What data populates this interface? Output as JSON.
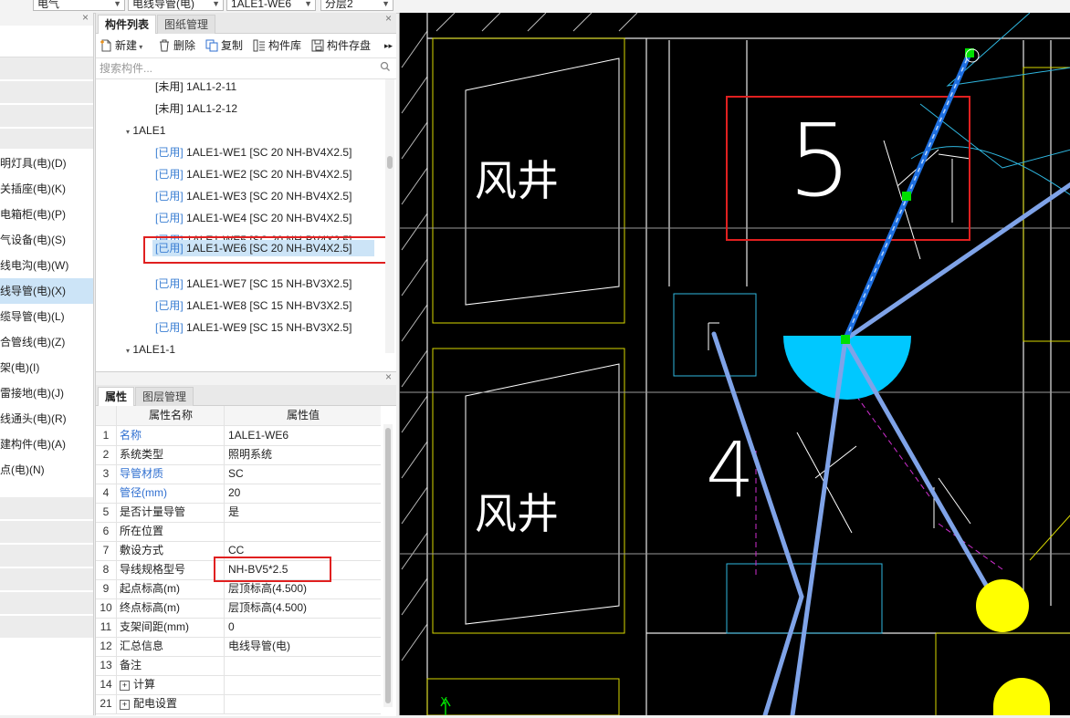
{
  "topbar": {
    "combos": [
      "电气",
      "电线导管(电)",
      "1ALE1-WE6",
      "分层2"
    ]
  },
  "leftnav": {
    "items": [
      {
        "label": "明灯具(电)(D)"
      },
      {
        "label": "关插座(电)(K)"
      },
      {
        "label": "电箱柜(电)(P)"
      },
      {
        "label": "气设备(电)(S)"
      },
      {
        "label": "线电沟(电)(W)"
      },
      {
        "label": "线导管(电)(X)"
      },
      {
        "label": "缆导管(电)(L)"
      },
      {
        "label": "合管线(电)(Z)"
      },
      {
        "label": "架(电)(I)"
      },
      {
        "label": "雷接地(电)(J)"
      },
      {
        "label": "线通头(电)(R)"
      },
      {
        "label": "建构件(电)(A)"
      },
      {
        "label": "点(电)(N)"
      }
    ]
  },
  "complist": {
    "tabs": [
      "构件列表",
      "图纸管理"
    ],
    "toolbar": {
      "new": "新建",
      "delete": "删除",
      "copy": "复制",
      "library": "构件库",
      "save": "构件存盘"
    },
    "search_placeholder": "搜索构件...",
    "tree": [
      {
        "tag": "[未用]",
        "name": "1AL1-2-11",
        "used": false,
        "level": 2
      },
      {
        "tag": "[未用]",
        "name": "1AL1-2-12",
        "used": false,
        "level": 2
      },
      {
        "tag": "",
        "name": "1ALE1",
        "used": false,
        "level": 1
      },
      {
        "tag": "[已用]",
        "name": "1ALE1-WE1 [SC 20 NH-BV4X2.5]",
        "used": true,
        "level": 2
      },
      {
        "tag": "[已用]",
        "name": "1ALE1-WE2 [SC 20 NH-BV4X2.5]",
        "used": true,
        "level": 2
      },
      {
        "tag": "[已用]",
        "name": "1ALE1-WE3 [SC 20 NH-BV4X2.5]",
        "used": true,
        "level": 2
      },
      {
        "tag": "[已用]",
        "name": "1ALE1-WE4 [SC 20 NH-BV4X2.5]",
        "used": true,
        "level": 2
      },
      {
        "tag": "[已用]",
        "name": "1ALE1-WE5 [SC 20 NH-BV4X2.5]",
        "used": true,
        "level": 2
      },
      {
        "tag": "[已用]",
        "name": "1ALE1-WE6 [SC 20 NH-BV4X2.5]",
        "used": true,
        "level": 2
      },
      {
        "tag": "[已用]",
        "name": "1ALE1-WE7 [SC 15 NH-BV3X2.5]",
        "used": true,
        "level": 2
      },
      {
        "tag": "[已用]",
        "name": "1ALE1-WE8 [SC 15 NH-BV3X2.5]",
        "used": true,
        "level": 2
      },
      {
        "tag": "[已用]",
        "name": "1ALE1-WE9 [SC 15 NH-BV3X2.5]",
        "used": true,
        "level": 2
      },
      {
        "tag": "",
        "name": "1ALE1-1",
        "used": false,
        "level": 1
      }
    ]
  },
  "props": {
    "tabs": [
      "属性",
      "图层管理"
    ],
    "col_name": "属性名称",
    "col_value": "属性值",
    "rows": [
      {
        "n": "1",
        "k": "名称",
        "v": "1ALE1-WE6",
        "blue": true
      },
      {
        "n": "2",
        "k": "系统类型",
        "v": "照明系统",
        "blue": false
      },
      {
        "n": "3",
        "k": "导管材质",
        "v": "SC",
        "blue": true
      },
      {
        "n": "4",
        "k": "管径(mm)",
        "v": "20",
        "blue": true
      },
      {
        "n": "5",
        "k": "是否计量导管",
        "v": "是",
        "blue": false
      },
      {
        "n": "6",
        "k": "所在位置",
        "v": "",
        "blue": false
      },
      {
        "n": "7",
        "k": "敷设方式",
        "v": "CC",
        "blue": false
      },
      {
        "n": "8",
        "k": "导线规格型号",
        "v": "NH-BV5*2.5",
        "blue": false
      },
      {
        "n": "9",
        "k": "起点标高(m)",
        "v": "层顶标高(4.500)",
        "blue": false
      },
      {
        "n": "10",
        "k": "终点标高(m)",
        "v": "层顶标高(4.500)",
        "blue": false
      },
      {
        "n": "11",
        "k": "支架间距(mm)",
        "v": "0",
        "blue": false
      },
      {
        "n": "12",
        "k": "汇总信息",
        "v": "电线导管(电)",
        "blue": false
      },
      {
        "n": "13",
        "k": "备注",
        "v": "",
        "blue": false
      },
      {
        "n": "14",
        "k": "计算",
        "v": "",
        "blue": false,
        "expand": true
      },
      {
        "n": "21",
        "k": "配电设置",
        "v": "",
        "blue": false,
        "expand": true
      }
    ]
  },
  "canvas": {
    "labels": {
      "fengjing": "风井",
      "num5": "5",
      "num4": "4",
      "axis_y": "Y"
    }
  },
  "colors": {
    "selection": "#cce4f7",
    "used_tag": "#3b7fd3",
    "highlight_box": "#e02020",
    "canvas_bg": "#000000",
    "pipe": "#7fa3e8",
    "lamp": "#00c8ff",
    "yellow_device": "#ffff00"
  }
}
